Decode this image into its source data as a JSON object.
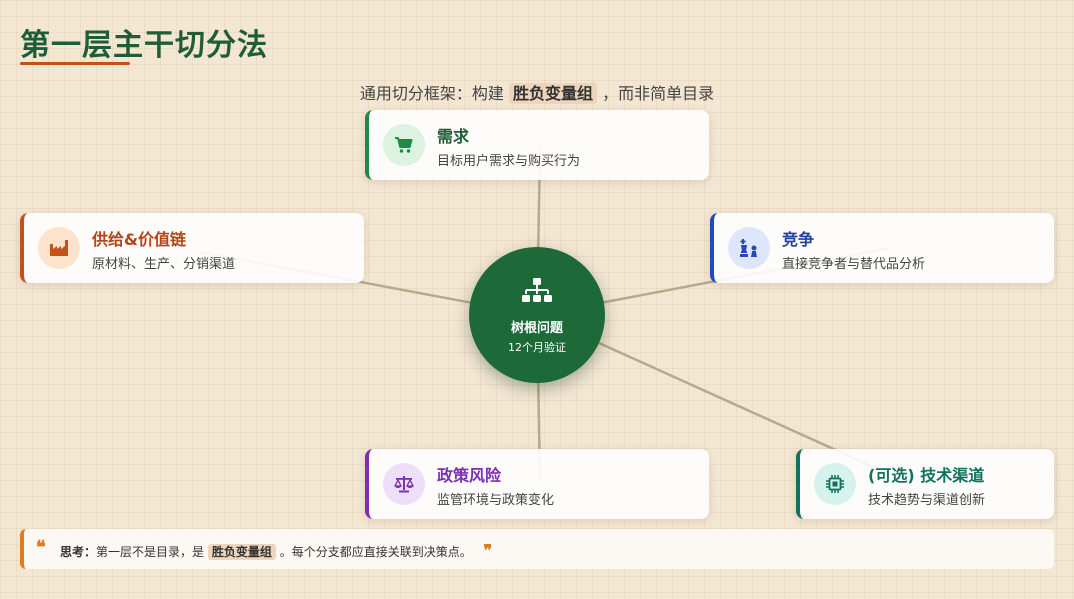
{
  "header": {
    "title": "第一层主干切分法",
    "subtitle_before": "通用切分框架：构建",
    "subtitle_highlight": "胜负变量组",
    "subtitle_after": "，而非简单目录"
  },
  "hub": {
    "icon": "sitemap-icon",
    "title": "树根问题",
    "subtitle": "12个月验证",
    "color": "#1d6938"
  },
  "branches": [
    {
      "id": "demand",
      "title": "需求",
      "desc": "目标用户需求与购买行为",
      "icon": "cart-icon",
      "accent": "#1d8a45",
      "icon_bg": "#dcf3e2",
      "title_color": "#1e5d36"
    },
    {
      "id": "supply",
      "title": "供给&价值链",
      "desc": "原材料、生产、分销渠道",
      "icon": "factory-icon",
      "accent": "#c2521c",
      "icon_bg": "#fde3cc",
      "title_color": "#b5441a"
    },
    {
      "id": "competition",
      "title": "竞争",
      "desc": "直接竞争者与替代品分析",
      "icon": "chess-icon",
      "accent": "#2449b8",
      "icon_bg": "#dde6fb",
      "title_color": "#23419e"
    },
    {
      "id": "policy",
      "title": "政策风险",
      "desc": "监管环境与政策变化",
      "icon": "scale-icon",
      "accent": "#7b2fb5",
      "icon_bg": "#eddff8",
      "title_color": "#7b2fb5"
    },
    {
      "id": "tech",
      "title": "(可选) 技术渠道",
      "desc": "技术趋势与渠道创新",
      "icon": "chip-icon",
      "accent": "#11735f",
      "icon_bg": "#d6f2ec",
      "title_color": "#11735f"
    }
  ],
  "note": {
    "label": "思考：",
    "before": "第一层不是目录，是",
    "highlight": "胜负变量组",
    "after": "。每个分支都应直接关联到决策点。",
    "open_quote": "❝",
    "close_quote": "❞"
  }
}
